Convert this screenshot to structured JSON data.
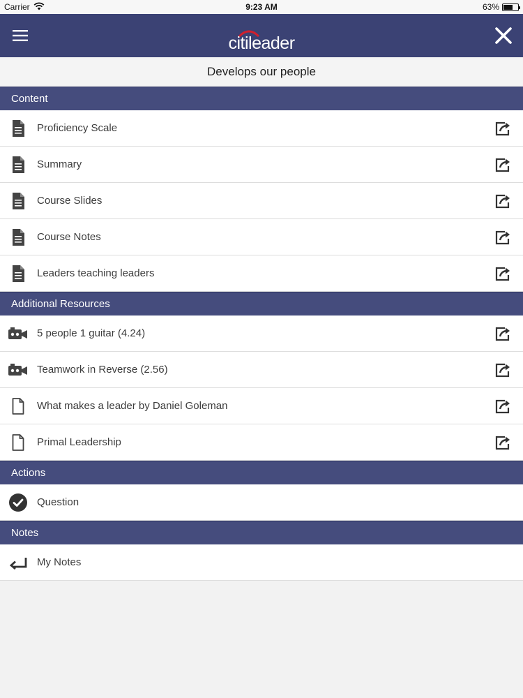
{
  "status_bar": {
    "carrier": "Carrier",
    "time": "9:23 AM",
    "battery": "63%",
    "battery_level": 0.63
  },
  "header": {
    "logo_text": "citileader",
    "subtitle": "Develops our people"
  },
  "colors": {
    "nav_bar": "#3b4274",
    "section_header": "#454c7d",
    "logo_arc": "#d0202e"
  },
  "sections": [
    {
      "title": "Content",
      "items": [
        {
          "label": "Proficiency Scale",
          "icon": "document-filled-icon"
        },
        {
          "label": "Summary",
          "icon": "document-filled-icon"
        },
        {
          "label": "Course Slides",
          "icon": "document-filled-icon"
        },
        {
          "label": "Course Notes",
          "icon": "document-filled-icon"
        },
        {
          "label": "Leaders teaching leaders",
          "icon": "document-filled-icon"
        }
      ]
    },
    {
      "title": "Additional Resources",
      "items": [
        {
          "label": "5 people 1 guitar (4.24)",
          "icon": "video-camera-icon"
        },
        {
          "label": "Teamwork in Reverse (2.56)",
          "icon": "video-camera-icon"
        },
        {
          "label": "What makes a leader by Daniel Goleman",
          "icon": "document-outline-icon"
        },
        {
          "label": "Primal Leadership",
          "icon": "document-outline-icon"
        }
      ]
    },
    {
      "title": "Actions",
      "items": [
        {
          "label": "Question",
          "icon": "checkmark-circle-icon"
        }
      ]
    },
    {
      "title": "Notes",
      "items": [
        {
          "label": "My Notes",
          "icon": "return-arrow-icon"
        }
      ]
    }
  ]
}
